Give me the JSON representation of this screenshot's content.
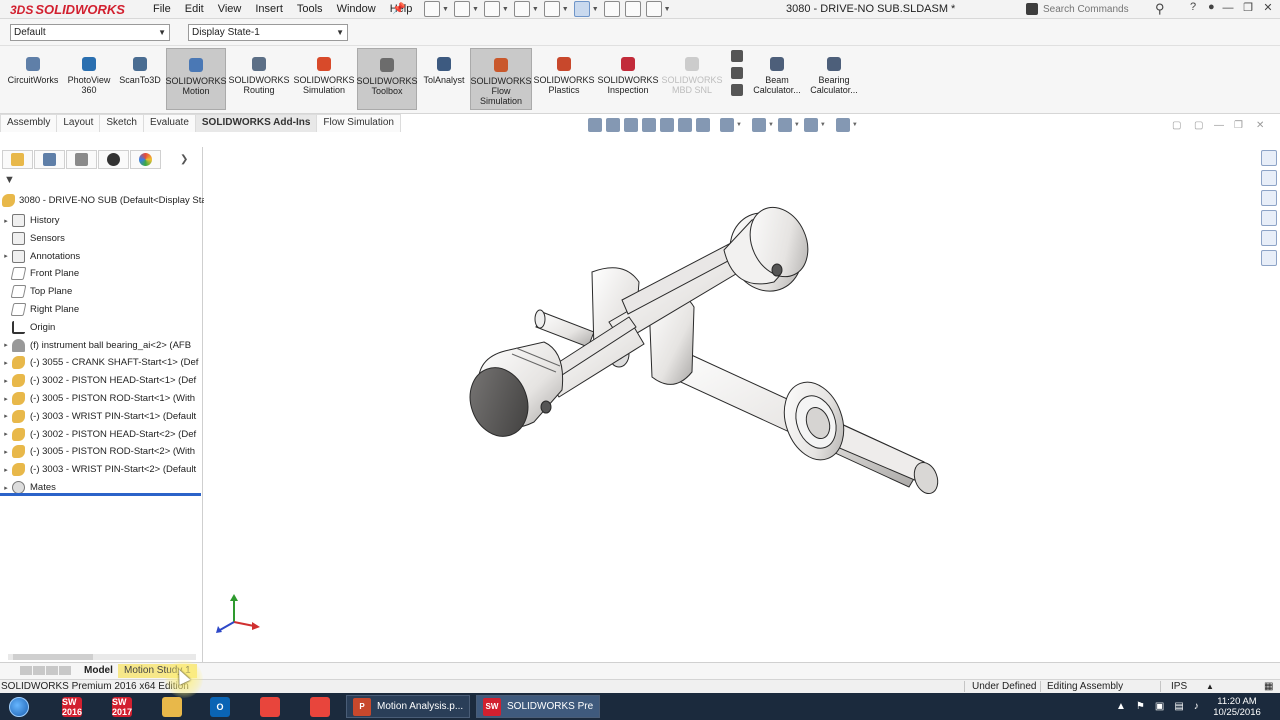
{
  "app": {
    "logo_ds": "3DS",
    "logo_text": "SOLIDWORKS",
    "doc_title": "3080 - DRIVE-NO SUB.SLDASM *",
    "search_placeholder": "Search Commands"
  },
  "menu": [
    "File",
    "Edit",
    "View",
    "Insert",
    "Tools",
    "Window",
    "Help"
  ],
  "config": {
    "configuration": "Default",
    "display_state": "Display State-1"
  },
  "ribbon": [
    {
      "label": "CircuitWorks",
      "icon": "circuitworks-icon",
      "color": "#5f7fa8",
      "active": false,
      "disabled": false
    },
    {
      "label": "PhotoView\n360",
      "icon": "photoview-icon",
      "color": "#2a6fb0",
      "active": false,
      "disabled": false
    },
    {
      "label": "ScanTo3D",
      "icon": "scanto3d-icon",
      "color": "#4a6d92",
      "active": false,
      "disabled": false
    },
    {
      "label": "SOLIDWORKS\nMotion",
      "icon": "motion-icon",
      "color": "#4a78b5",
      "active": true,
      "disabled": false
    },
    {
      "label": "SOLIDWORKS\nRouting",
      "icon": "routing-icon",
      "color": "#5c6f86",
      "active": false,
      "disabled": false
    },
    {
      "label": "SOLIDWORKS\nSimulation",
      "icon": "simulation-icon",
      "color": "#d84a2a",
      "active": false,
      "disabled": false
    },
    {
      "label": "SOLIDWORKS\nToolbox",
      "icon": "toolbox-icon",
      "color": "#6c6c6c",
      "active": true,
      "disabled": false
    },
    {
      "label": "TolAnalyst",
      "icon": "tolanalyst-icon",
      "color": "#3d5a80",
      "active": false,
      "disabled": false
    },
    {
      "label": "SOLIDWORKS\nFlow\nSimulation",
      "icon": "flow-simulation-icon",
      "color": "#c9582c",
      "active": true,
      "disabled": false
    },
    {
      "label": "SOLIDWORKS\nPlastics",
      "icon": "plastics-icon",
      "color": "#c8482c",
      "active": false,
      "disabled": false
    },
    {
      "label": "SOLIDWORKS\nInspection",
      "icon": "inspection-icon",
      "color": "#c22b3a",
      "active": false,
      "disabled": false
    },
    {
      "label": "SOLIDWORKS\nMBD SNL",
      "icon": "mbd-icon",
      "color": "#cccccc",
      "active": false,
      "disabled": true
    },
    {
      "label": "Beam\nCalculator...",
      "icon": "beam-calculator-icon",
      "color": "#4d5f7a",
      "active": false,
      "disabled": false
    },
    {
      "label": "Bearing\nCalculator...",
      "icon": "bearing-calculator-icon",
      "color": "#4d5f7a",
      "active": false,
      "disabled": false
    }
  ],
  "command_tabs": [
    {
      "label": "Assembly",
      "active": false
    },
    {
      "label": "Layout",
      "active": false
    },
    {
      "label": "Sketch",
      "active": false
    },
    {
      "label": "Evaluate",
      "active": false
    },
    {
      "label": "SOLIDWORKS Add-Ins",
      "active": true
    },
    {
      "label": "Flow Simulation",
      "active": false
    }
  ],
  "feature_manager": {
    "root": "3080 - DRIVE-NO SUB  (Default<Display Sta",
    "items": [
      {
        "label": "History",
        "type": "folder",
        "expandable": true
      },
      {
        "label": "Sensors",
        "type": "folder",
        "expandable": false
      },
      {
        "label": "Annotations",
        "type": "folder",
        "expandable": true
      },
      {
        "label": "Front Plane",
        "type": "plane",
        "expandable": false
      },
      {
        "label": "Top Plane",
        "type": "plane",
        "expandable": false
      },
      {
        "label": "Right Plane",
        "type": "plane",
        "expandable": false
      },
      {
        "label": "Origin",
        "type": "origin",
        "expandable": false
      },
      {
        "label": "(f) instrument ball bearing_ai<2> (AFB",
        "type": "bearing",
        "expandable": true
      },
      {
        "label": "(-) 3055 - CRANK SHAFT-Start<1> (Def",
        "type": "part",
        "expandable": true
      },
      {
        "label": "(-) 3002 - PISTON HEAD-Start<1> (Def",
        "type": "part",
        "expandable": true
      },
      {
        "label": "(-) 3005 - PISTON ROD-Start<1> (With",
        "type": "part",
        "expandable": true
      },
      {
        "label": "(-) 3003 - WRIST PIN-Start<1> (Default",
        "type": "part",
        "expandable": true
      },
      {
        "label": "(-) 3002 - PISTON HEAD-Start<2> (Def",
        "type": "part",
        "expandable": true
      },
      {
        "label": "(-) 3005 - PISTON ROD-Start<2> (With",
        "type": "part",
        "expandable": true
      },
      {
        "label": "(-) 3003 - WRIST PIN-Start<2> (Default",
        "type": "part",
        "expandable": true
      },
      {
        "label": "Mates",
        "type": "mate",
        "expandable": true
      }
    ]
  },
  "bottom_tabs": {
    "model": "Model",
    "motion_study": "Motion Study 1"
  },
  "status": {
    "edition": "SOLIDWORKS Premium 2016 x64 Edition",
    "defined": "Under Defined",
    "mode": "Editing Assembly",
    "units": "IPS"
  },
  "taskbar": {
    "apps": [
      {
        "name": "solidworks-2016-icon",
        "label": "SW 2016",
        "color": "#d2202f"
      },
      {
        "name": "solidworks-2017-icon",
        "label": "SW 2017",
        "color": "#d2202f"
      },
      {
        "name": "file-explorer-icon",
        "label": "",
        "color": "#e8b84a"
      },
      {
        "name": "outlook-icon",
        "label": "O",
        "color": "#0a64b4"
      },
      {
        "name": "chrome-icon",
        "label": "",
        "color": "#e8453c"
      },
      {
        "name": "apps-grid-icon",
        "label": "",
        "color": "#e8453c"
      }
    ],
    "windows": [
      {
        "label": "Motion Analysis.p...",
        "icon_text": "P",
        "color": "#c8482c"
      },
      {
        "label": "SOLIDWORKS Pre...",
        "icon_text": "SW",
        "color": "#d2202f"
      }
    ],
    "time": "11:20 AM",
    "date": "10/25/2016"
  },
  "colors": {
    "accent": "#2b63c9",
    "brand": "#d2202f",
    "taskbar": "#1b2a3d"
  }
}
